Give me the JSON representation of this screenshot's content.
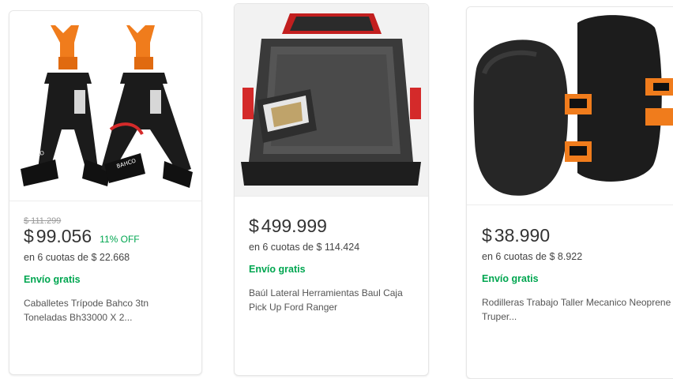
{
  "products": [
    {
      "original_price": "$ 111.299",
      "currency": "$",
      "price": "99.056",
      "discount": "11% OFF",
      "installments": "en 6 cuotas de $ 22.668",
      "shipping": "Envío gratis",
      "title": "Caballetes Trípode Bahco 3tn Toneladas Bh33000 X 2...",
      "image_icon": "jack-stands-image"
    },
    {
      "currency": "$",
      "price": "499.999",
      "installments": "en 6 cuotas de $ 114.424",
      "shipping": "Envío gratis",
      "title": "Baúl Lateral Herramientas Baul Caja Pick Up Ford Ranger",
      "image_icon": "pickup-toolbox-image"
    },
    {
      "currency": "$",
      "price": "38.990",
      "installments": "en 6 cuotas de $ 8.922",
      "shipping": "Envío gratis",
      "title": "Rodilleras Trabajo Taller Mecanico Neoprene Truper...",
      "image_icon": "knee-pads-image"
    }
  ],
  "colors": {
    "price_text": "#333333",
    "discount_green": "#00a650",
    "shipping_green": "#00a650",
    "strike_gray": "#999999",
    "jack_orange": "#f07c1c",
    "truck_red": "#d42a2a"
  }
}
